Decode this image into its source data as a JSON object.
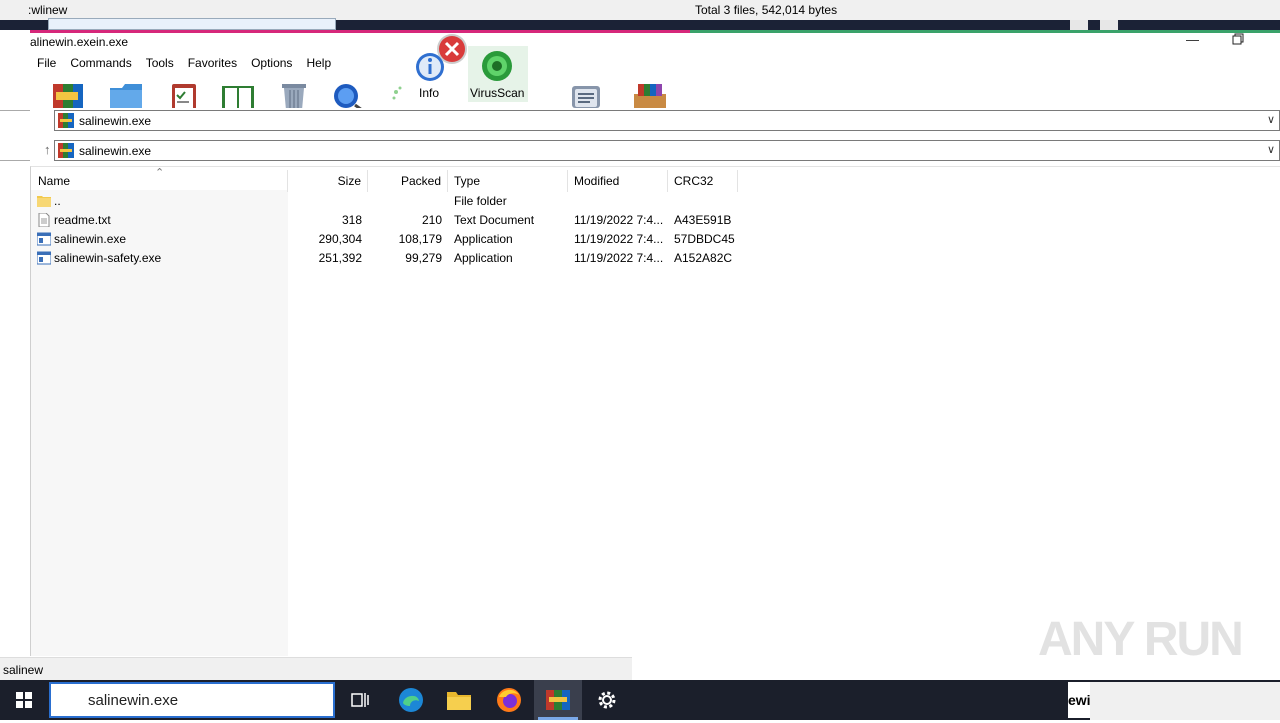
{
  "ghost": {
    "left_text": ":wlinew",
    "total_text": "Total 3 files, 542,014 bytes"
  },
  "window": {
    "title": "alinewin.exein.exe"
  },
  "menu": [
    "File",
    "Commands",
    "Tools",
    "Favorites",
    "Options",
    "Help"
  ],
  "toolbar": {
    "info_label": "Info",
    "virusscan_label": "VirusScan"
  },
  "address": {
    "path_top": "salinewin.exe",
    "path_bottom": "salinewin.exe"
  },
  "columns": {
    "name": "Name",
    "size": "Size",
    "packed": "Packed",
    "type": "Type",
    "modified": "Modified",
    "crc": "CRC32"
  },
  "files": [
    {
      "name": "..",
      "size": "",
      "packed": "",
      "type": "File folder",
      "modified": "",
      "crc": "",
      "icon": "folder-icon"
    },
    {
      "name": "readme.txt",
      "size": "318",
      "packed": "210",
      "type": "Text Document",
      "modified": "11/19/2022 7:4...",
      "crc": "A43E591B",
      "icon": "text-file-icon"
    },
    {
      "name": "salinewin.exe",
      "size": "290,304",
      "packed": "108,179",
      "type": "Application",
      "modified": "11/19/2022 7:4...",
      "crc": "57DBDC45",
      "icon": "exe-file-icon"
    },
    {
      "name": "salinewin-safety.exe",
      "size": "251,392",
      "packed": "99,279",
      "type": "Application",
      "modified": "11/19/2022 7:4...",
      "crc": "A152A82C",
      "icon": "exe-file-icon"
    }
  ],
  "status": {
    "text": "salinew"
  },
  "watermark": "ANY RUN",
  "taskbar": {
    "search_value": "salinewin.exe",
    "tray_text": "ewi"
  },
  "colors": {
    "taskbar": "#1b1f2b",
    "accent_pink": "#d6277a",
    "accent_green": "#3aa26a",
    "search_border": "#2a6fd0"
  }
}
